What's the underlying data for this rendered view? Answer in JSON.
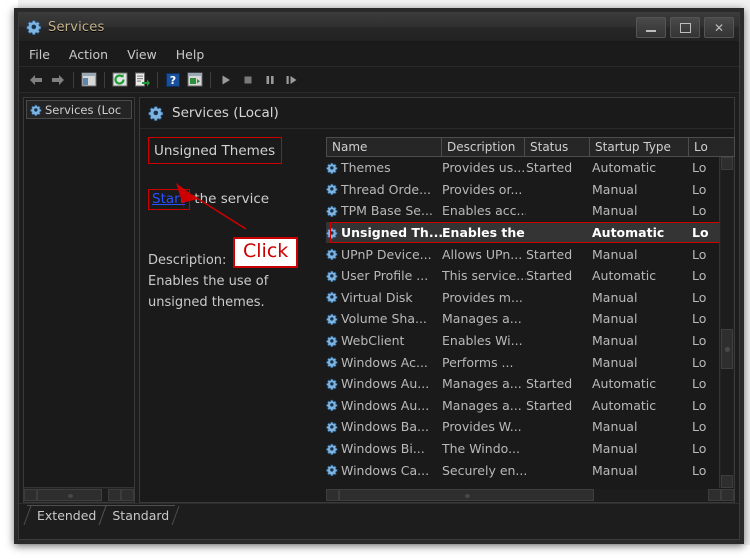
{
  "window": {
    "title": "Services",
    "icon": "services-gear-icon",
    "controls": {
      "minimize": "–",
      "maximize": "□",
      "close": "✕"
    }
  },
  "menubar": {
    "items": [
      {
        "label": "File"
      },
      {
        "label": "Action"
      },
      {
        "label": "View"
      },
      {
        "label": "Help"
      }
    ]
  },
  "toolbar": {
    "items": [
      {
        "name": "back-icon"
      },
      {
        "name": "forward-icon"
      },
      {
        "name": "show-hide-console-tree-icon"
      },
      {
        "name": "refresh-icon"
      },
      {
        "name": "export-list-icon"
      },
      {
        "name": "help-icon"
      },
      {
        "name": "properties-icon"
      },
      {
        "name": "start-service-icon"
      },
      {
        "name": "stop-service-icon"
      },
      {
        "name": "pause-service-icon"
      },
      {
        "name": "restart-service-icon"
      }
    ]
  },
  "tree": {
    "root_label": "Services (Loc"
  },
  "details": {
    "pane_title": "Services (Local)",
    "service_name": "Unsigned Themes",
    "start_link": "Start",
    "start_suffix": " the service",
    "description_label": "Description:",
    "description_lines": [
      "Enables the use of",
      "unsigned themes."
    ],
    "annotation": {
      "click_label": "Click",
      "highlight_color": "#cc0000",
      "link_color": "#2a50ff"
    }
  },
  "list": {
    "columns": [
      {
        "key": "name",
        "label": "Name"
      },
      {
        "key": "description",
        "label": "Description"
      },
      {
        "key": "status",
        "label": "Status"
      },
      {
        "key": "startup",
        "label": "Startup Type"
      },
      {
        "key": "logon",
        "label": "Lo"
      }
    ],
    "rows": [
      {
        "name": "Themes",
        "description": "Provides us...",
        "status": "Started",
        "startup": "Automatic",
        "logon": "Lo",
        "selected": false
      },
      {
        "name": "Thread Orde...",
        "description": "Provides or...",
        "status": "",
        "startup": "Manual",
        "logon": "Lo",
        "selected": false
      },
      {
        "name": "TPM Base Se...",
        "description": "Enables acc...",
        "status": "",
        "startup": "Manual",
        "logon": "Lo",
        "selected": false
      },
      {
        "name": "Unsigned Th...",
        "description": "Enables the...",
        "status": "",
        "startup": "Automatic",
        "logon": "Lo",
        "selected": true
      },
      {
        "name": "UPnP Device...",
        "description": "Allows UPn...",
        "status": "Started",
        "startup": "Manual",
        "logon": "Lo",
        "selected": false
      },
      {
        "name": "User Profile ...",
        "description": "This service...",
        "status": "Started",
        "startup": "Automatic",
        "logon": "Lo",
        "selected": false
      },
      {
        "name": "Virtual Disk",
        "description": "Provides m...",
        "status": "",
        "startup": "Manual",
        "logon": "Lo",
        "selected": false
      },
      {
        "name": "Volume Sha...",
        "description": "Manages a...",
        "status": "",
        "startup": "Manual",
        "logon": "Lo",
        "selected": false
      },
      {
        "name": "WebClient",
        "description": "Enables Wi...",
        "status": "",
        "startup": "Manual",
        "logon": "Lo",
        "selected": false
      },
      {
        "name": "Windows Ac...",
        "description": "Performs ...",
        "status": "",
        "startup": "Manual",
        "logon": "Lo",
        "selected": false
      },
      {
        "name": "Windows Au...",
        "description": "Manages a...",
        "status": "Started",
        "startup": "Automatic",
        "logon": "Lo",
        "selected": false
      },
      {
        "name": "Windows Au...",
        "description": "Manages a...",
        "status": "Started",
        "startup": "Automatic",
        "logon": "Lo",
        "selected": false
      },
      {
        "name": "Windows Ba...",
        "description": "Provides W...",
        "status": "",
        "startup": "Manual",
        "logon": "Lo",
        "selected": false
      },
      {
        "name": "Windows Bi...",
        "description": "The Windo...",
        "status": "",
        "startup": "Manual",
        "logon": "Lo",
        "selected": false
      },
      {
        "name": "Windows Ca...",
        "description": "Securely en...",
        "status": "",
        "startup": "Manual",
        "logon": "Lo",
        "selected": false
      }
    ]
  },
  "tabs": [
    {
      "label": "Extended",
      "active": false
    },
    {
      "label": "Standard",
      "active": true
    }
  ]
}
